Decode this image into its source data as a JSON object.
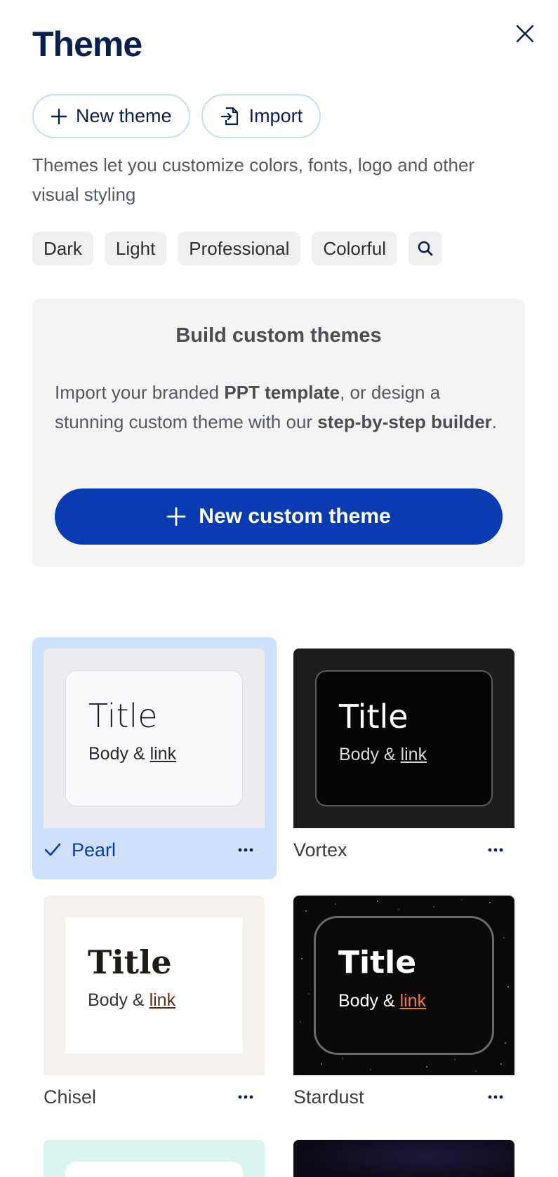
{
  "header": {
    "title": "Theme"
  },
  "actions": {
    "new_theme": "New theme",
    "import": "Import"
  },
  "description": "Themes let you customize colors, fonts, logo and other visual styling",
  "tags": [
    "Dark",
    "Light",
    "Professional",
    "Colorful"
  ],
  "promo": {
    "title": "Build custom themes",
    "text_1": "Import your branded ",
    "bold_1": "PPT template",
    "text_2": ", or design a stunning custom theme with our ",
    "bold_2": "step-by-step builder",
    "text_3": ".",
    "button": "New custom theme"
  },
  "themes": [
    {
      "name": "Pearl",
      "title": "Title",
      "body": "Body & ",
      "link": "link",
      "selected": true
    },
    {
      "name": "Vortex",
      "title": "Title",
      "body": "Body & ",
      "link": "link",
      "selected": false
    },
    {
      "name": "Chisel",
      "title": "Title",
      "body": "Body & ",
      "link": "link",
      "selected": false
    },
    {
      "name": "Stardust",
      "title": "Title",
      "body": "Body & ",
      "link": "link",
      "selected": false
    }
  ],
  "colors": {
    "primary": "#0a3bb0",
    "heading": "#0b1f4d",
    "selected_bg": "#cfe0fb",
    "stardust_link": "#f07a3a"
  }
}
